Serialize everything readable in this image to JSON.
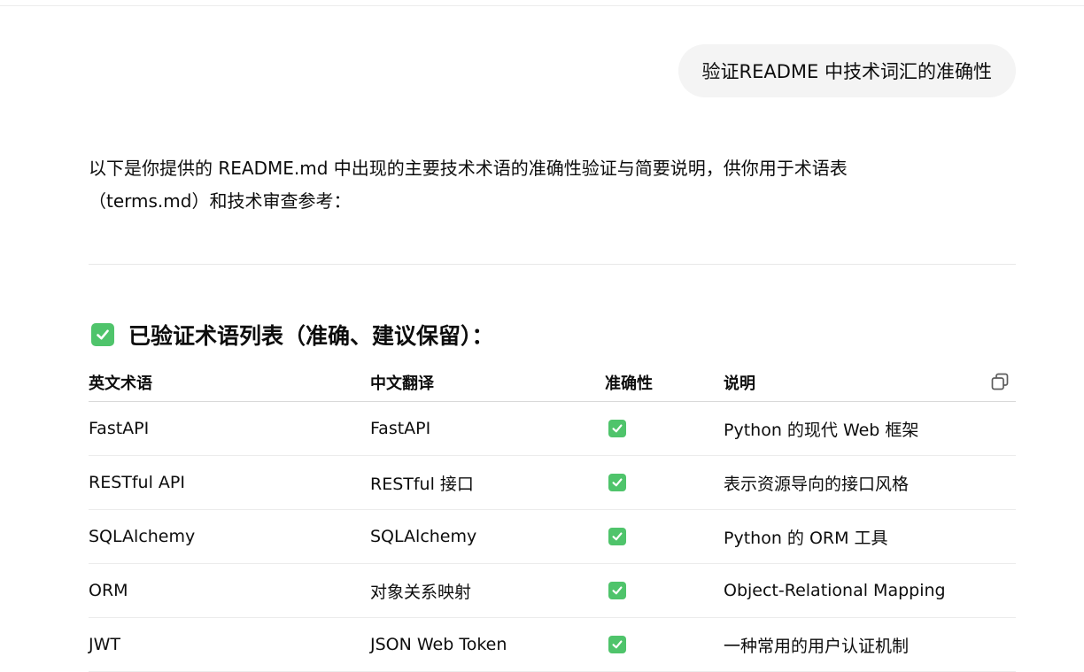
{
  "user_message": "验证README 中技术词汇的准确性",
  "intro_text": "以下是你提供的 README.md 中出现的主要技术术语的准确性验证与简要说明，供你用于术语表（terms.md）和技术审查参考：",
  "section": {
    "icon": "check-mark-button-emoji",
    "title": "已验证术语列表（准确、建议保留）："
  },
  "table": {
    "headers": [
      "英文术语",
      "中文翻译",
      "准确性",
      "说明"
    ],
    "copy_icon": "copy-icon",
    "rows": [
      {
        "term": "FastAPI",
        "translation": "FastAPI",
        "accuracy": "✅",
        "description": "Python 的现代 Web 框架"
      },
      {
        "term": "RESTful API",
        "translation": "RESTful 接口",
        "accuracy": "✅",
        "description": "表示资源导向的接口风格"
      },
      {
        "term": "SQLAlchemy",
        "translation": "SQLAlchemy",
        "accuracy": "✅",
        "description": "Python 的 ORM 工具"
      },
      {
        "term": "ORM",
        "translation": "对象关系映射",
        "accuracy": "✅",
        "description": "Object-Relational Mapping"
      },
      {
        "term": "JWT",
        "translation": "JSON Web Token",
        "accuracy": "✅",
        "description": "一种常用的用户认证机制"
      }
    ]
  },
  "colors": {
    "check_green": "#4fc46b",
    "bubble_bg": "#f4f4f4",
    "text": "#0d0d0d"
  }
}
